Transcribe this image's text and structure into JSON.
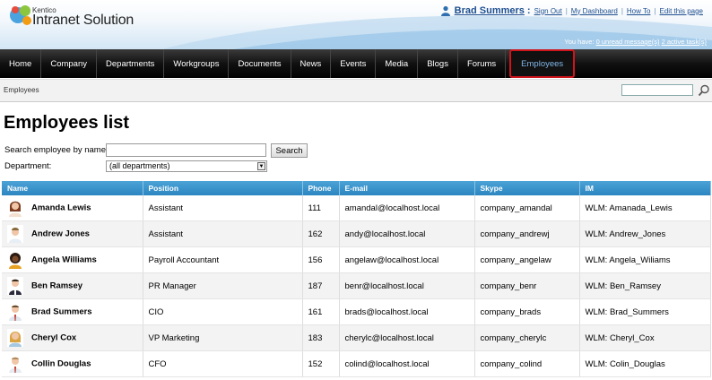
{
  "header": {
    "logo_small": "Kentico",
    "logo_big": "Intranet Solution",
    "user_name": "Brad Summers",
    "links": [
      "Sign Out",
      "My Dashboard",
      "How To",
      "Edit this page"
    ],
    "messages_prefix": "You have: ",
    "unread_messages": "0 unread message(s)",
    "tasks": "2 active task(s)"
  },
  "nav": {
    "items": [
      "Home",
      "Company",
      "Departments",
      "Workgroups",
      "Documents",
      "News",
      "Events",
      "Media",
      "Blogs",
      "Forums",
      "Employees"
    ],
    "active": "Employees"
  },
  "breadcrumb": "Employees",
  "main": {
    "title": "Employees list",
    "search_label": "Search employee by name:",
    "search_value": "",
    "search_button": "Search",
    "department_label": "Department:",
    "department_selected": "(all departments)"
  },
  "table": {
    "columns": [
      "Name",
      "Position",
      "Phone",
      "E-mail",
      "Skype",
      "IM"
    ],
    "rows": [
      {
        "name": "Amanda Lewis",
        "position": "Assistant",
        "phone": "111",
        "email": "amandal@localhost.local",
        "skype": "company_amandal",
        "im": "WLM: Amanada_Lewis"
      },
      {
        "name": "Andrew Jones",
        "position": "Assistant",
        "phone": "162",
        "email": "andy@localhost.local",
        "skype": "company_andrewj",
        "im": "WLM: Andrew_Jones"
      },
      {
        "name": "Angela Williams",
        "position": "Payroll Accountant",
        "phone": "156",
        "email": "angelaw@localhost.local",
        "skype": "company_angelaw",
        "im": "WLM: Angela_Wiliams"
      },
      {
        "name": "Ben Ramsey",
        "position": "PR Manager",
        "phone": "187",
        "email": "benr@localhost.local",
        "skype": "company_benr",
        "im": "WLM: Ben_Ramsey"
      },
      {
        "name": "Brad Summers",
        "position": "CIO",
        "phone": "161",
        "email": "brads@localhost.local",
        "skype": "company_brads",
        "im": "WLM: Brad_Summers"
      },
      {
        "name": "Cheryl Cox",
        "position": "VP Marketing",
        "phone": "183",
        "email": "cherylc@localhost.local",
        "skype": "company_cherylc",
        "im": "WLM: Cheryl_Cox"
      },
      {
        "name": "Collin Douglas",
        "position": "CFO",
        "phone": "152",
        "email": "colind@localhost.local",
        "skype": "company_colind",
        "im": "WLM: Colin_Douglas"
      }
    ]
  },
  "colors": {
    "nav_active_text": "#7fb7e8",
    "nav_active_border": "#d0141c",
    "table_header": "#2c85c0",
    "link": "#1e4f8f"
  }
}
